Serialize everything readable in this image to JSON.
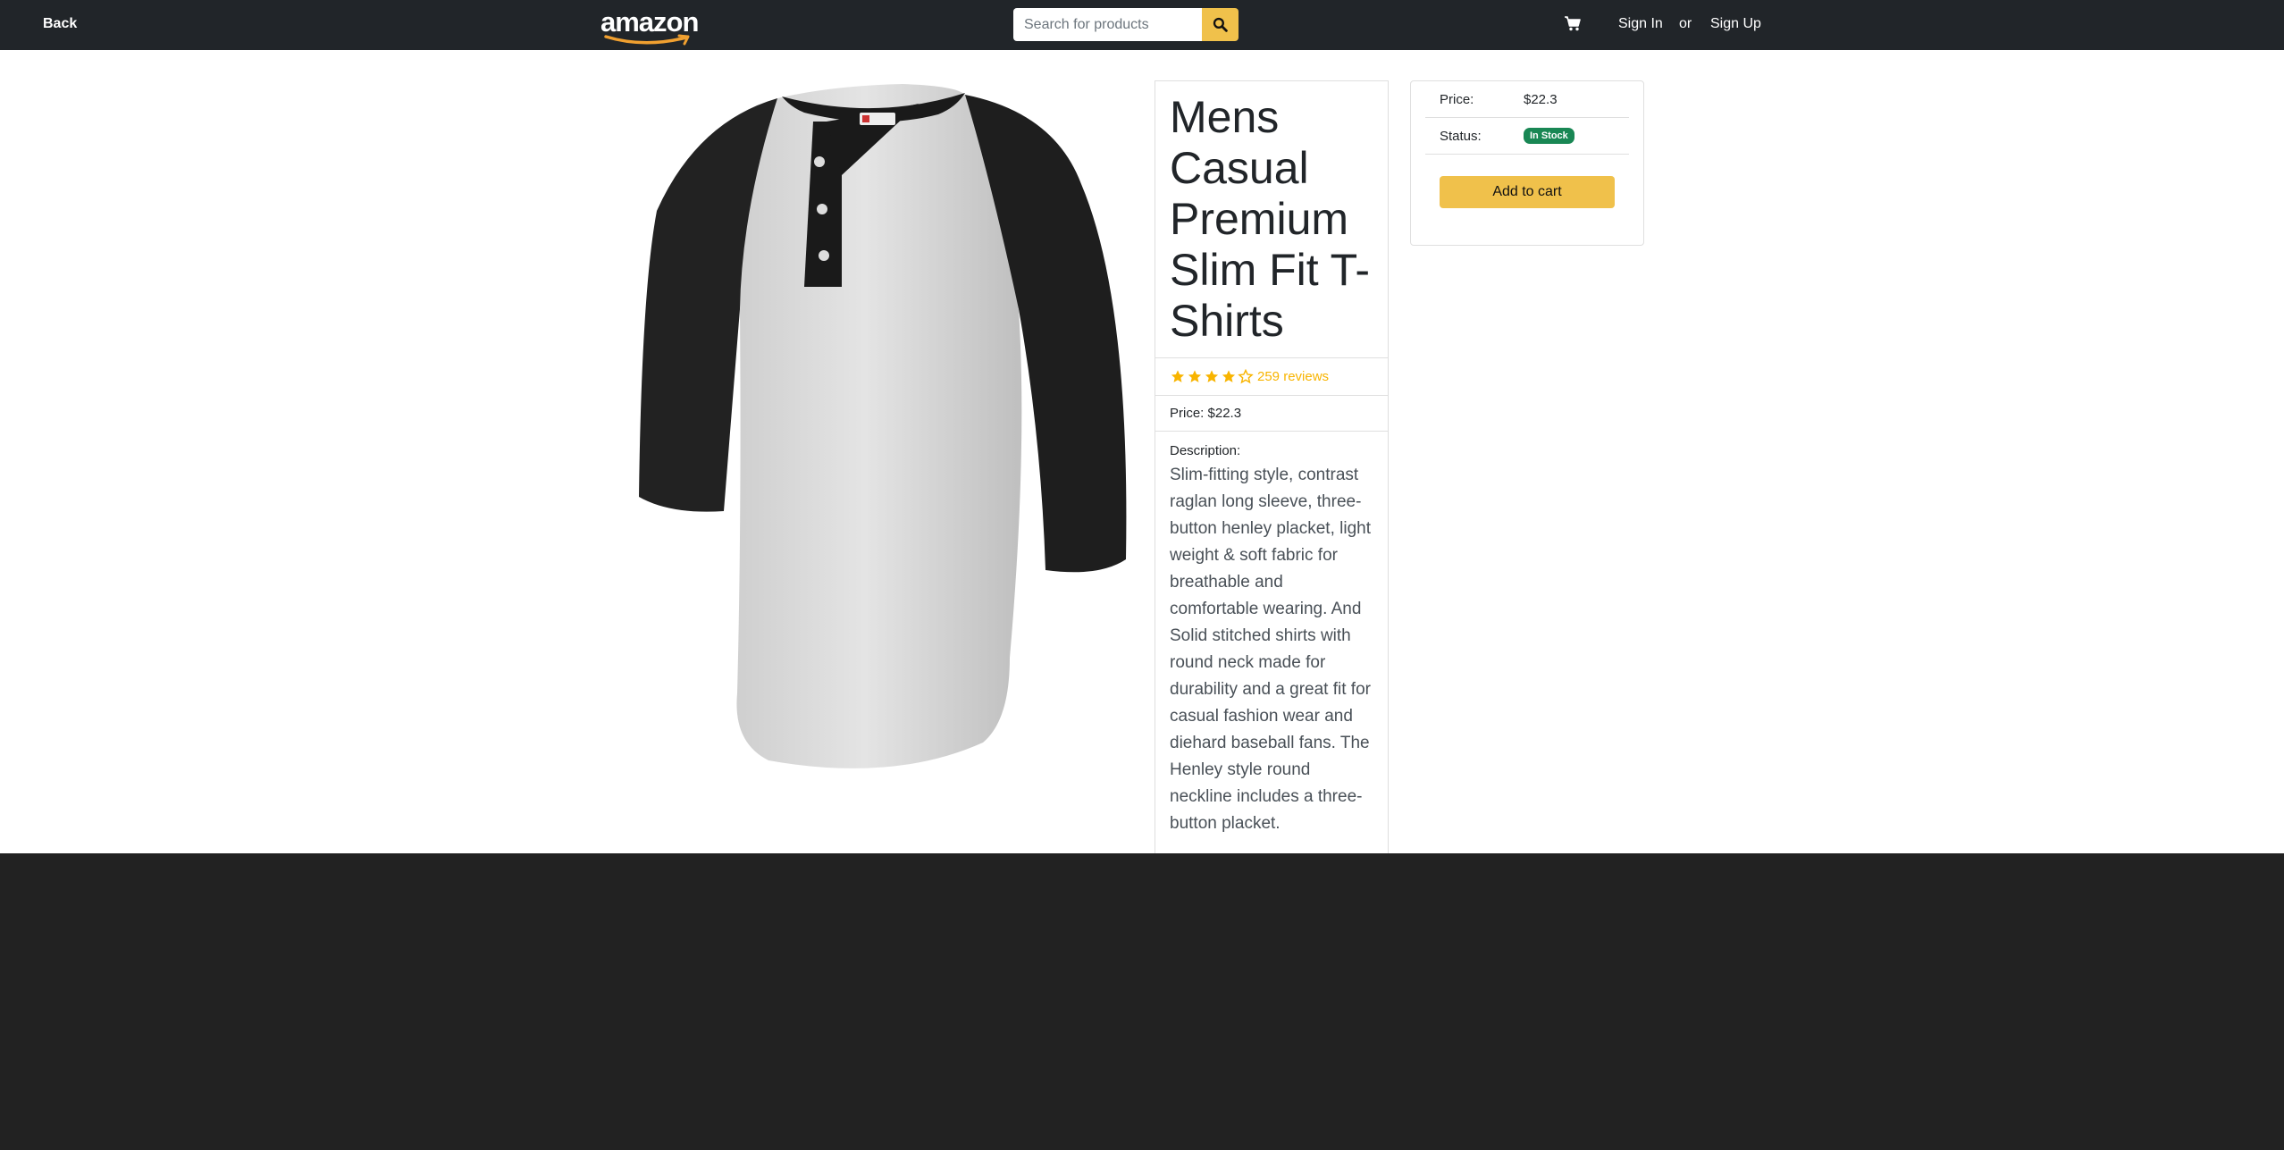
{
  "navbar": {
    "back_label": "Back",
    "logo_text": "amazon",
    "search_placeholder": "Search for products",
    "signin_label": "Sign In",
    "or_label": "or",
    "signup_label": "Sign Up",
    "icons": [
      "search-icon",
      "cart-icon"
    ]
  },
  "product": {
    "title": "Mens Casual Premium Slim Fit T-Shirts",
    "rating": 4.1,
    "reviews_label": "259 reviews",
    "price_label": "Price: $22.3",
    "description_label": "Description:",
    "description": "Slim-fitting style, contrast raglan long sleeve, three-button henley placket, light weight & soft fabric for breathable and comfortable wearing. And Solid stitched shirts with round neck made for durability and a great fit for casual fashion wear and diehard baseball fans. The Henley style round neckline includes a three-button placket."
  },
  "buybox": {
    "price_label": "Price:",
    "price_value": "$22.3",
    "status_label": "Status:",
    "status_value": "In Stock",
    "add_to_cart_label": "Add to cart"
  },
  "colors": {
    "navbar": "#212529",
    "accent": "#f0c14b",
    "stars": "#f8b400",
    "in_stock": "#198754",
    "footer": "#222222"
  }
}
